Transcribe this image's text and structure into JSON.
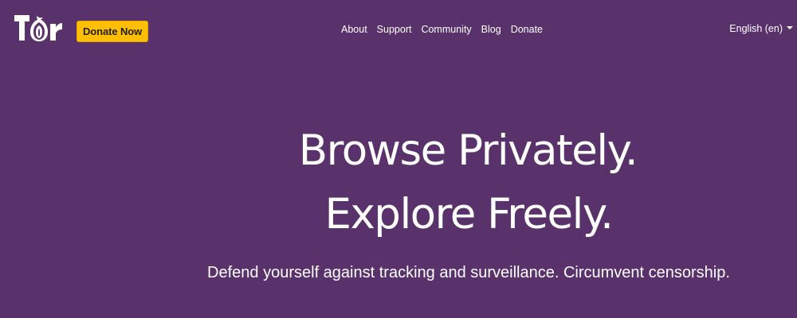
{
  "header": {
    "logo_text": "Tor",
    "donate_button": "Donate Now",
    "nav": [
      "About",
      "Support",
      "Community",
      "Blog",
      "Donate"
    ],
    "language": "English (en)"
  },
  "hero": {
    "line1": "Browse Privately.",
    "line2": "Explore Freely.",
    "subtitle": "Defend yourself against tracking and surveillance. Circumvent censorship."
  },
  "colors": {
    "background": "#59316b",
    "donate_button": "#ffbf00",
    "text": "#ffffff"
  },
  "icons": {
    "logo": "tor-onion-logo",
    "language_caret": "caret-down-icon"
  }
}
